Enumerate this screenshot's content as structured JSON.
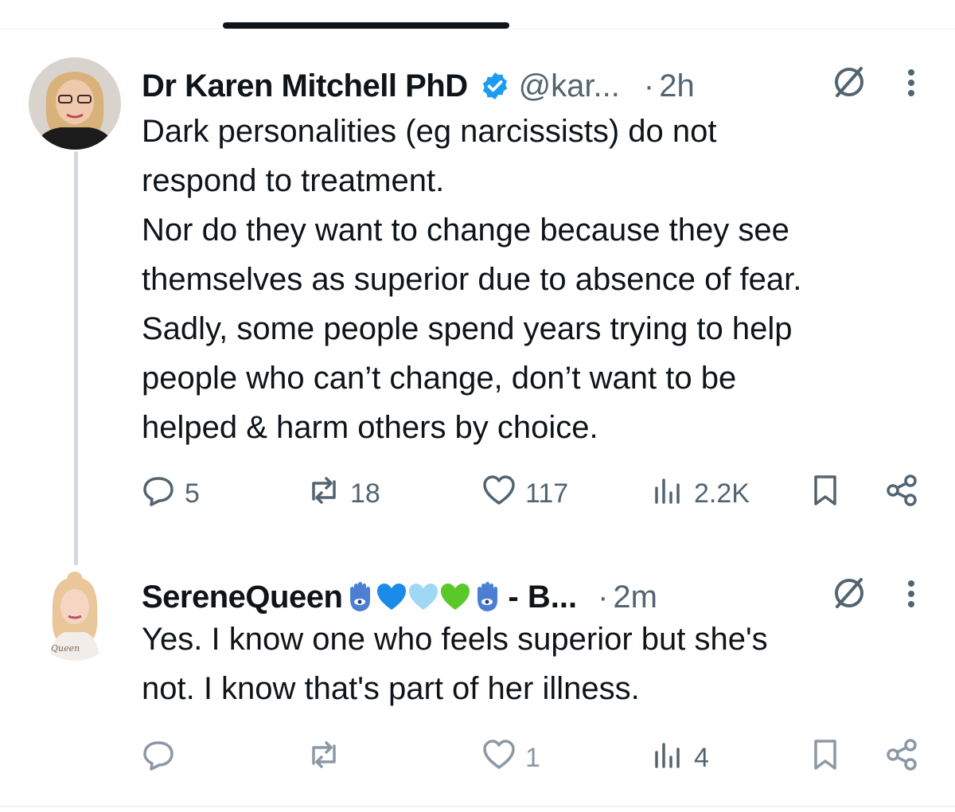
{
  "tweets": [
    {
      "author_name": "Dr Karen Mitchell PhD",
      "handle": "@kar...",
      "time": "2h",
      "text": "Dark personalities (eg narcissists) do not\nrespond to treatment.\nNor do they want to change because they see\nthemselves as superior due to absence of fear.\nSadly, some people spend years trying to help\npeople who can’t change, don’t want to be\nhelped & harm others by choice.",
      "replies": "5",
      "reposts": "18",
      "likes": "117",
      "views": "2.2K"
    },
    {
      "author_name": "SereneQueen",
      "name_emojis": [
        "hamsa-emoji",
        "blue-heart-emoji",
        "light-blue-heart-emoji",
        "green-heart-emoji",
        "hamsa-emoji"
      ],
      "name_trail": "- B...",
      "time": "2m",
      "text": "Yes.  I know one who feels superior but she's\nnot. I know that's part of her illness.",
      "replies": "",
      "reposts": "",
      "likes": "1",
      "views": "4",
      "avatar_caption": "Queen"
    }
  ],
  "separator": "·",
  "colors": {
    "text": "#0f1419",
    "secondary": "#536471",
    "verified_blue": "#1d9bf0",
    "thread_line": "#cfd9de",
    "divider": "#eff3f4"
  },
  "icons": [
    "verified-badge-icon",
    "grok-icon",
    "more-icon",
    "reply-icon",
    "repost-icon",
    "like-icon",
    "views-icon",
    "bookmark-icon",
    "share-icon"
  ]
}
